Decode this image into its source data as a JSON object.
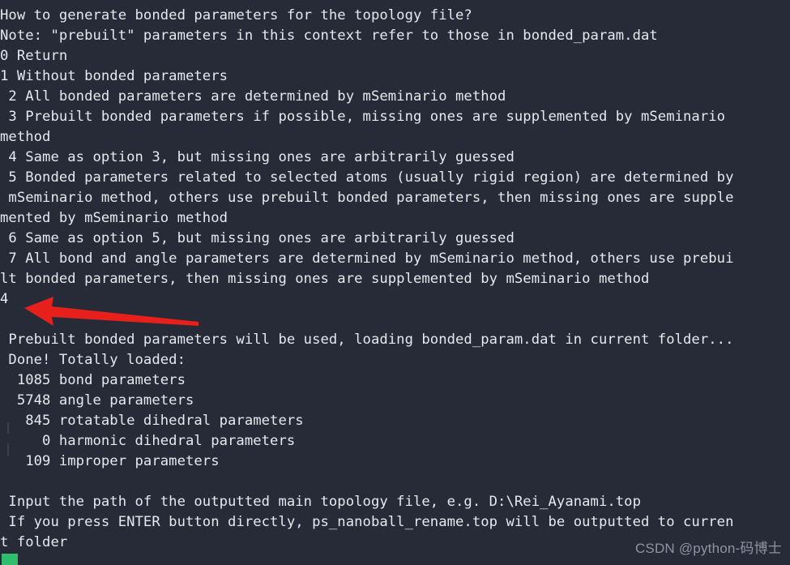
{
  "terminal": {
    "background_color": "#272b38",
    "text_color": "#e6e8ee",
    "arrow_color": "#e8201c",
    "cursor_color": "#2fbe6e",
    "lines": [
      "How to generate bonded parameters for the topology file?",
      "Note: \"prebuilt\" parameters in this context refer to those in bonded_param.dat",
      "0 Return",
      "1 Without bonded parameters",
      " 2 All bonded parameters are determined by mSeminario method",
      " 3 Prebuilt bonded parameters if possible, missing ones are supplemented by mSeminario",
      "method",
      " 4 Same as option 3, but missing ones are arbitrarily guessed",
      " 5 Bonded parameters related to selected atoms (usually rigid region) are determined by",
      " mSeminario method, others use prebuilt bonded parameters, then missing ones are supple",
      "mented by mSeminario method",
      " 6 Same as option 5, but missing ones are arbitrarily guessed",
      " 7 All bond and angle parameters are determined by mSeminario method, others use prebui",
      "lt bonded parameters, then missing ones are supplemented by mSeminario method",
      "4",
      "",
      " Prebuilt bonded parameters will be used, loading bonded_param.dat in current folder...",
      " Done! Totally loaded:",
      "  1085 bond parameters",
      "  5748 angle parameters",
      "   845 rotatable dihedral parameters",
      "     0 harmonic dihedral parameters",
      "   109 improper parameters",
      "",
      " Input the path of the outputted main topology file, e.g. D:\\Rei_Ayanami.top",
      " If you press ENTER button directly, ps_nanoball_rename.top will be outputted to curren",
      "t folder"
    ],
    "user_input_value": "4",
    "watermark": "CSDN @python-码博士"
  }
}
